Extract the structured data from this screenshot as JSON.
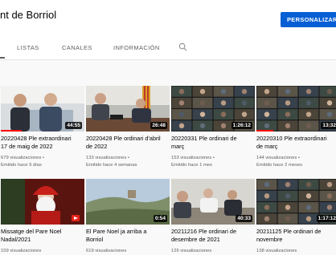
{
  "channel": {
    "name": "nt de Borriol",
    "customize_label": "PERSONALIZAR C"
  },
  "tabs": [
    {
      "label": "LISTAS"
    },
    {
      "label": "CANALES"
    },
    {
      "label": "INFORMACIÓN"
    }
  ],
  "videos": [
    {
      "title_line1": "20220428 Ple extraordinari",
      "title_line2": "17 de maig de 2022",
      "views": "679 visualizaciones •",
      "time": "Emitido hace 9 días",
      "duration": "44:55",
      "progress": 0.25
    },
    {
      "title_line1": "20220428 Ple ordinari d'abril",
      "title_line2": "de 2022",
      "views": "133 visualizaciones •",
      "time": "Emitido hace 4 semanas",
      "duration": "26:48",
      "progress": 0
    },
    {
      "title_line1": "20220331 Ple ordinari de",
      "title_line2": "març",
      "views": "153 visualizaciones •",
      "time": "Emitido hace 1 mes",
      "duration": "1:26:12",
      "progress": 0
    },
    {
      "title_line1": "20220310 Ple extraordinari",
      "title_line2": "de març",
      "views": "144 visualizaciones •",
      "time": "Emitido hace 2 meses",
      "duration": "13:32",
      "progress": 0.2
    },
    {
      "title_line1": "Missatge del Pare Noel",
      "title_line2": "Nadal/2021",
      "views": "159 visualizaciones",
      "time": "",
      "duration": "",
      "progress": 0
    },
    {
      "title_line1": "El Pare Noel ja arriba a",
      "title_line2": "Borriol",
      "views": "619 visualizaciones",
      "time": "",
      "duration": "0:54",
      "progress": 0
    },
    {
      "title_line1": "20211216 Ple ordinari de",
      "title_line2": "desembre de 2021",
      "views": "126 visualizaciones",
      "time": "",
      "duration": "40:33",
      "progress": 0
    },
    {
      "title_line1": "20211125 Ple ordinari de",
      "title_line2": "novembre",
      "views": "138 visualizaciones",
      "time": "",
      "duration": "1:17:12",
      "progress": 0
    }
  ]
}
